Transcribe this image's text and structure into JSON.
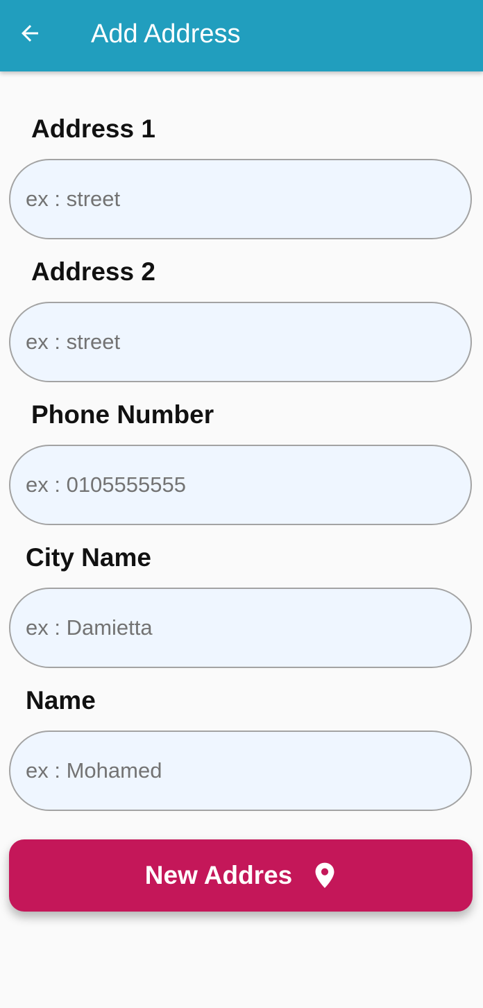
{
  "appbar": {
    "title": "Add Address",
    "back_icon": "arrow-left-icon",
    "color": "#219ebe"
  },
  "form": {
    "fields": [
      {
        "label": "Address 1",
        "placeholder": "ex : street",
        "value": ""
      },
      {
        "label": "Address 2",
        "placeholder": "ex : street",
        "value": ""
      },
      {
        "label": "Phone Number",
        "placeholder": "ex : 0105555555",
        "value": ""
      },
      {
        "label": "City Name",
        "placeholder": "ex : Damietta",
        "value": ""
      },
      {
        "label": "Name",
        "placeholder": "ex : Mohamed",
        "value": ""
      }
    ]
  },
  "submit": {
    "label": "New Addres",
    "icon": "location-pin-icon",
    "color": "#c41759"
  }
}
